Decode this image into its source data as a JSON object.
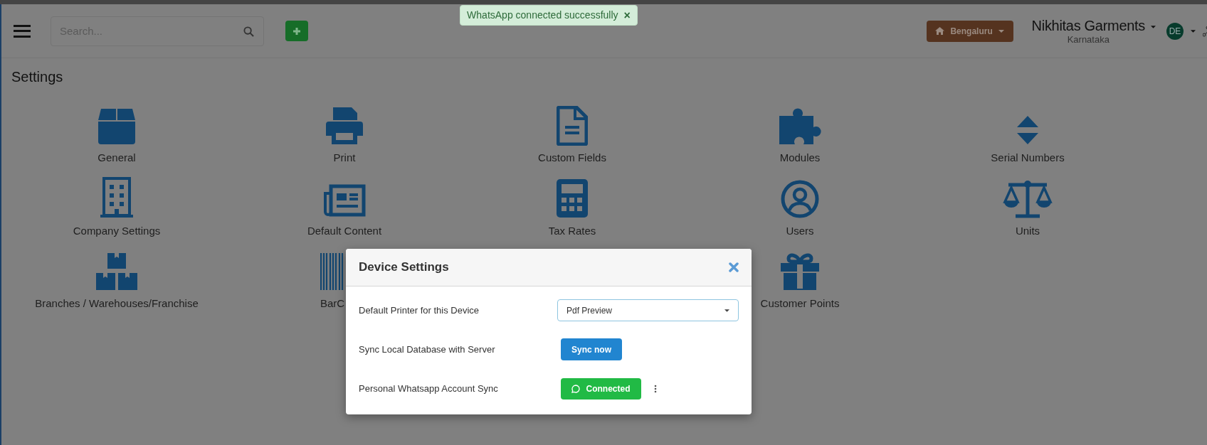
{
  "toast": {
    "text": "WhatsApp connected successfully",
    "close": "×"
  },
  "navbar": {
    "search": {
      "placeholder": "Search..."
    },
    "branch_button": "Bengaluru",
    "company": {
      "name": "Nikhitas Garments",
      "region": "Karnataka"
    },
    "avatar": "DE"
  },
  "page_title": "Settings",
  "settings_items": [
    {
      "label": "General",
      "kind": "tile"
    },
    {
      "label": "Print",
      "kind": "tile"
    },
    {
      "label": "Custom Fields",
      "kind": "tile"
    },
    {
      "label": "Modules",
      "kind": "tile"
    },
    {
      "label": "Serial Numbers",
      "kind": "tile"
    },
    {
      "label": "Company Settings",
      "kind": "tile"
    },
    {
      "label": "Default Content",
      "kind": "tile"
    },
    {
      "label": "Tax Rates",
      "kind": "tile"
    },
    {
      "label": "Users",
      "kind": "tile"
    },
    {
      "label": "Units",
      "kind": "tile"
    },
    {
      "label": "Branches / Warehouses/Franchise",
      "kind": "tile"
    },
    {
      "label": "BarC",
      "kind": "covered"
    },
    {
      "label": "Customer Points",
      "kind": "tile"
    }
  ],
  "modal": {
    "title": "Device Settings",
    "rows": [
      {
        "label": "Default Printer for this Device",
        "kind": "select",
        "value": "Pdf Preview"
      },
      {
        "label": "Sync Local Database with Server",
        "kind": "button",
        "value": "Sync now"
      },
      {
        "label": "Personal Whatsapp Account Sync",
        "kind": "status",
        "value": "Connected"
      }
    ]
  }
}
